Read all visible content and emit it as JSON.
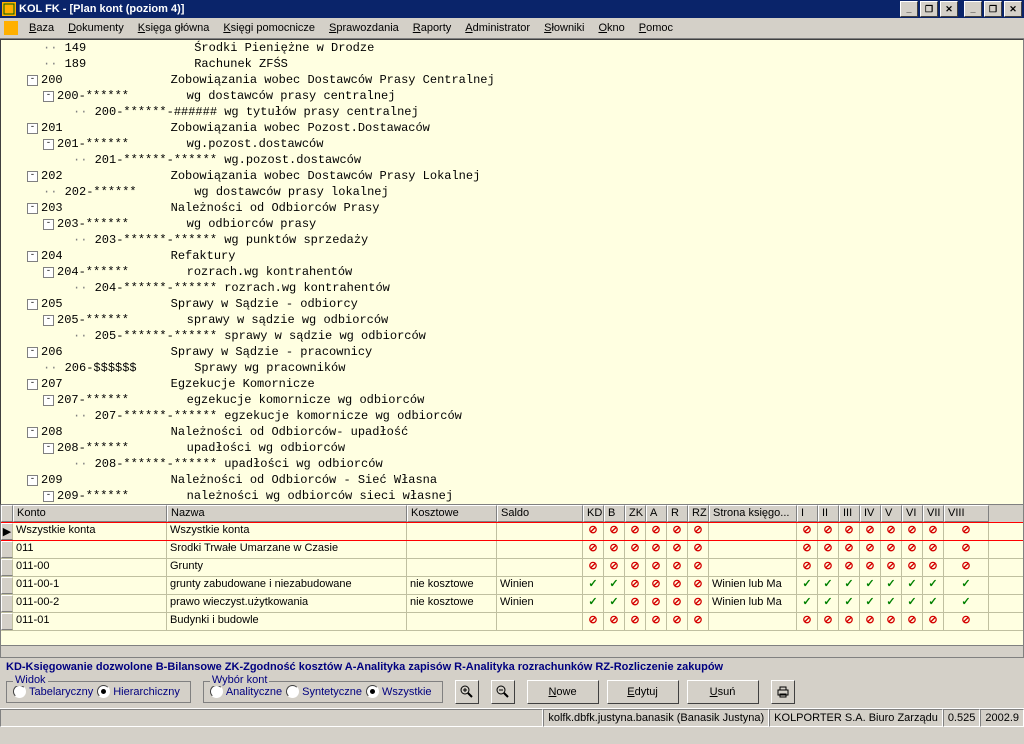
{
  "title": "KOL FK - [Plan kont (poziom 4)]",
  "menu": [
    "Baza",
    "Dokumenty",
    "Księga główna",
    "Księgi pomocnicze",
    "Sprawozdania",
    "Raporty",
    "Administrator",
    "Słowniki",
    "Okno",
    "Pomoc"
  ],
  "tree": [
    {
      "indent": 42,
      "toggle": "",
      "code": "149",
      "desc": "Środki Pieniężne w Drodze"
    },
    {
      "indent": 42,
      "toggle": "",
      "code": "189",
      "desc": "Rachunek ZFŚS"
    },
    {
      "indent": 26,
      "toggle": "-",
      "code": "200",
      "desc": "Zobowiązania wobec Dostawców Prasy Centralnej"
    },
    {
      "indent": 42,
      "toggle": "-",
      "code": "200-******",
      "desc": "wg dostawców prasy centralnej"
    },
    {
      "indent": 72,
      "toggle": "",
      "code": "200-******-######",
      "desc": "wg tytułów prasy centralnej"
    },
    {
      "indent": 26,
      "toggle": "-",
      "code": "201",
      "desc": "Zobowiązania wobec Pozost.Dostawaców"
    },
    {
      "indent": 42,
      "toggle": "-",
      "code": "201-******",
      "desc": "wg.pozost.dostawców"
    },
    {
      "indent": 72,
      "toggle": "",
      "code": "201-******-******",
      "desc": "wg.pozost.dostawców"
    },
    {
      "indent": 26,
      "toggle": "-",
      "code": "202",
      "desc": "Zobowiązania wobec Dostawców Prasy Lokalnej"
    },
    {
      "indent": 42,
      "toggle": "",
      "code": "202-******",
      "desc": "wg dostawców prasy lokalnej"
    },
    {
      "indent": 26,
      "toggle": "-",
      "code": "203",
      "desc": "Należności od Odbiorców Prasy"
    },
    {
      "indent": 42,
      "toggle": "-",
      "code": "203-******",
      "desc": "wg odbiorców prasy"
    },
    {
      "indent": 72,
      "toggle": "",
      "code": "203-******-******",
      "desc": "wg punktów sprzedaży"
    },
    {
      "indent": 26,
      "toggle": "-",
      "code": "204",
      "desc": "Refaktury"
    },
    {
      "indent": 42,
      "toggle": "-",
      "code": "204-******",
      "desc": "rozrach.wg kontrahentów"
    },
    {
      "indent": 72,
      "toggle": "",
      "code": "204-******-******",
      "desc": "rozrach.wg kontrahentów"
    },
    {
      "indent": 26,
      "toggle": "-",
      "code": "205",
      "desc": "Sprawy w Sądzie - odbiorcy"
    },
    {
      "indent": 42,
      "toggle": "-",
      "code": "205-******",
      "desc": "sprawy w sądzie wg odbiorców"
    },
    {
      "indent": 72,
      "toggle": "",
      "code": "205-******-******",
      "desc": "sprawy w sądzie wg odbiorców"
    },
    {
      "indent": 26,
      "toggle": "-",
      "code": "206",
      "desc": "Sprawy w Sądzie - pracownicy"
    },
    {
      "indent": 42,
      "toggle": "",
      "code": "206-$$$$$$",
      "desc": "Sprawy wg pracowników"
    },
    {
      "indent": 26,
      "toggle": "-",
      "code": "207",
      "desc": "Egzekucje Komornicze"
    },
    {
      "indent": 42,
      "toggle": "-",
      "code": "207-******",
      "desc": "egzekucje komornicze wg odbiorców"
    },
    {
      "indent": 72,
      "toggle": "",
      "code": "207-******-******",
      "desc": "egzekucje komornicze wg odbiorców"
    },
    {
      "indent": 26,
      "toggle": "-",
      "code": "208",
      "desc": "Należności od Odbiorców- upadłość"
    },
    {
      "indent": 42,
      "toggle": "-",
      "code": "208-******",
      "desc": "upadłości wg odbiorców"
    },
    {
      "indent": 72,
      "toggle": "",
      "code": "208-******-******",
      "desc": "upadłości wg odbiorców"
    },
    {
      "indent": 26,
      "toggle": "-",
      "code": "209",
      "desc": "Należności od Odbiorców - Sieć Własna"
    },
    {
      "indent": 42,
      "toggle": "-",
      "code": "209-******",
      "desc": "należności wg odbiorców sieci własnej"
    }
  ],
  "grid": {
    "cols": [
      "Konto",
      "Nazwa",
      "Kosztowe",
      "Saldo",
      "KD",
      "B",
      "ZK",
      "A",
      "R",
      "RZ",
      "Strona księgo...",
      "I",
      "II",
      "III",
      "IV",
      "V",
      "VI",
      "VII",
      "VIII"
    ],
    "rows": [
      {
        "ind": "▶",
        "konto": "Wszystkie konta",
        "nazwa": "Wszystkie konta",
        "koszt": "",
        "saldo": "",
        "s1": [
          "n",
          "n",
          "n",
          "n",
          "n",
          "n"
        ],
        "str": "",
        "s2": [
          "n",
          "n",
          "n",
          "n",
          "n",
          "n",
          "n"
        ],
        "v8": "n"
      },
      {
        "ind": "",
        "konto": "011",
        "nazwa": "Srodki Trwałe Umarzane w Czasie",
        "koszt": "",
        "saldo": "",
        "s1": [
          "n",
          "n",
          "n",
          "n",
          "n",
          "n"
        ],
        "str": "",
        "s2": [
          "n",
          "n",
          "n",
          "n",
          "n",
          "n",
          "n"
        ],
        "v8": "n"
      },
      {
        "ind": "",
        "konto": "011-00",
        "nazwa": "Grunty",
        "koszt": "",
        "saldo": "",
        "s1": [
          "n",
          "n",
          "n",
          "n",
          "n",
          "n"
        ],
        "str": "",
        "s2": [
          "n",
          "n",
          "n",
          "n",
          "n",
          "n",
          "n"
        ],
        "v8": "n"
      },
      {
        "ind": "",
        "konto": "011-00-1",
        "nazwa": "grunty zabudowane i niezabudowane",
        "koszt": "nie kosztowe",
        "saldo": "Winien",
        "s1": [
          "y",
          "y",
          "n",
          "n",
          "n",
          "n"
        ],
        "str": "Winien lub Ma",
        "s2": [
          "y",
          "y",
          "y",
          "y",
          "y",
          "y",
          "y"
        ],
        "v8": "y"
      },
      {
        "ind": "",
        "konto": "011-00-2",
        "nazwa": "prawo wieczyst.użytkowania",
        "koszt": "nie kosztowe",
        "saldo": "Winien",
        "s1": [
          "y",
          "y",
          "n",
          "n",
          "n",
          "n"
        ],
        "str": "Winien lub Ma",
        "s2": [
          "y",
          "y",
          "y",
          "y",
          "y",
          "y",
          "y"
        ],
        "v8": "y"
      },
      {
        "ind": "",
        "konto": "011-01",
        "nazwa": "Budynki i budowle",
        "koszt": "",
        "saldo": "",
        "s1": [
          "n",
          "n",
          "n",
          "n",
          "n",
          "n"
        ],
        "str": "",
        "s2": [
          "n",
          "n",
          "n",
          "n",
          "n",
          "n",
          "n"
        ],
        "v8": "n"
      }
    ]
  },
  "legend": "KD-Księgowanie dozwolone  B-Bilansowe  ZK-Zgodność kosztów  A-Analityka zapisów  R-Analityka rozrachunków  RZ-Rozliczenie zakupów",
  "panel": {
    "widok": {
      "title": "Widok",
      "opts": [
        "Tabelaryczny",
        "Hierarchiczny"
      ],
      "sel": 1
    },
    "wybor": {
      "title": "Wybór kont",
      "opts": [
        "Analityczne",
        "Syntetyczne",
        "Wszystkie"
      ],
      "sel": 2
    },
    "btns": [
      "Nowe",
      "Edytuj",
      "Usuń"
    ]
  },
  "status": [
    "kolfk.dbfk.justyna.banasik (Banasik Justyna)",
    "KOLPORTER S.A. Biuro Zarządu",
    "0.525",
    "2002.9"
  ]
}
